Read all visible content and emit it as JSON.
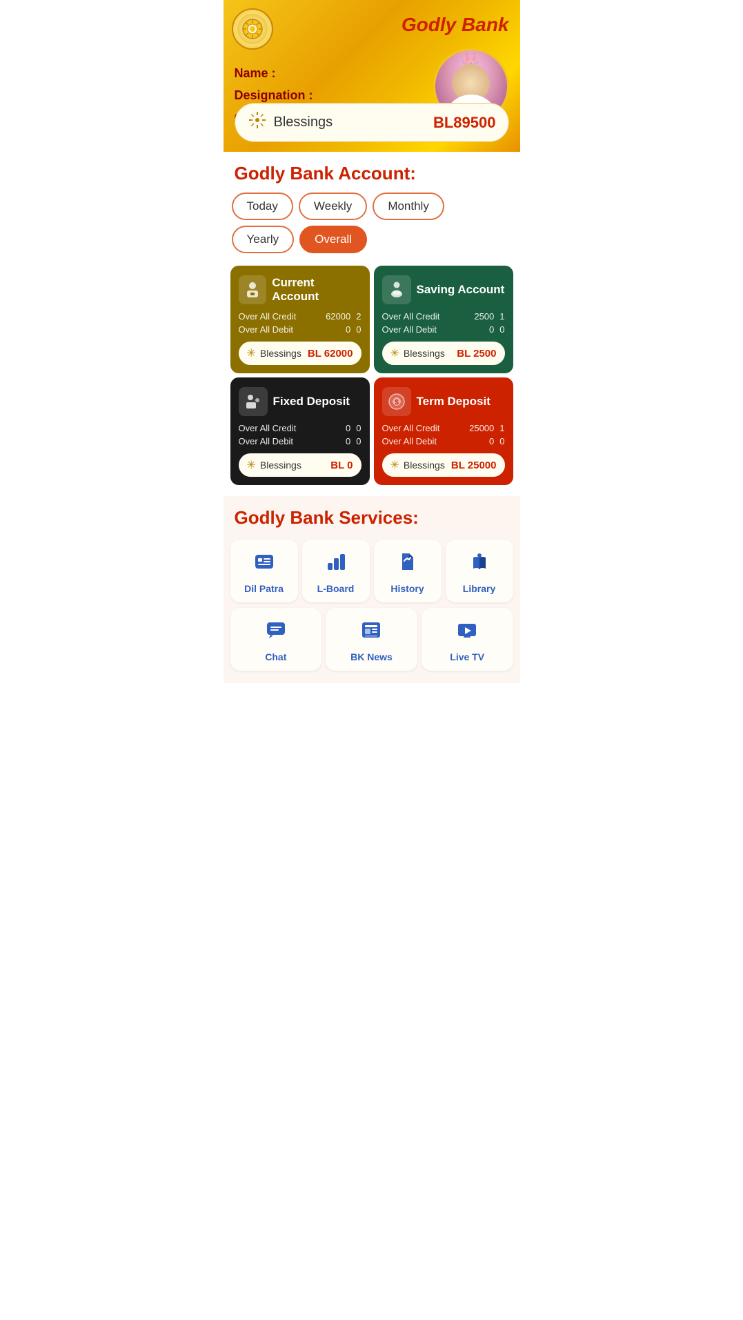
{
  "header": {
    "app_title": "Godly Bank",
    "name_label": "Name :",
    "designation_label": "Designation :",
    "crown_label": "Crown :",
    "blessings_label": "Blessings",
    "blessings_value": "BL89500"
  },
  "account_section": {
    "title": "Godly Bank Account:",
    "tabs": [
      "Today",
      "Weekly",
      "Monthly",
      "Yearly",
      "Overall"
    ],
    "active_tab": "Overall",
    "cards": [
      {
        "title": "Current Account",
        "icon": "banker",
        "type": "current",
        "over_all_credit_label": "Over All Credit",
        "over_all_credit_amount": "62000",
        "over_all_credit_count": "2",
        "over_all_debit_label": "Over All Debit",
        "over_all_debit_amount": "0",
        "over_all_debit_count": "0",
        "blessings_label": "Blessings",
        "blessings_value": "BL 62000",
        "color": "gold"
      },
      {
        "title": "Saving Account",
        "icon": "saving",
        "type": "saving",
        "over_all_credit_label": "Over All Credit",
        "over_all_credit_amount": "2500",
        "over_all_credit_count": "1",
        "over_all_debit_label": "Over All Debit",
        "over_all_debit_amount": "0",
        "over_all_debit_count": "0",
        "blessings_label": "Blessings",
        "blessings_value": "BL 2500",
        "color": "green"
      },
      {
        "title": "Fixed Deposit",
        "icon": "fixed",
        "type": "fixed",
        "over_all_credit_label": "Over All Credit",
        "over_all_credit_amount": "0",
        "over_all_credit_count": "0",
        "over_all_debit_label": "Over All Debit",
        "over_all_debit_amount": "0",
        "over_all_debit_count": "0",
        "blessings_label": "Blessings",
        "blessings_value": "BL 0",
        "color": "black"
      },
      {
        "title": "Term Deposit",
        "icon": "term",
        "type": "term",
        "over_all_credit_label": "Over All Credit",
        "over_all_credit_amount": "25000",
        "over_all_credit_count": "1",
        "over_all_debit_label": "Over All Debit",
        "over_all_debit_amount": "0",
        "over_all_debit_count": "0",
        "blessings_label": "Blessings",
        "blessings_value": "BL 25000",
        "color": "red"
      }
    ]
  },
  "services_section": {
    "title": "Godly Bank Services:",
    "row1": [
      {
        "label": "Dil Patra",
        "icon": "message-grid"
      },
      {
        "label": "L-Board",
        "icon": "bar-chart"
      },
      {
        "label": "History",
        "icon": "scroll"
      },
      {
        "label": "Library",
        "icon": "book"
      }
    ],
    "row2": [
      {
        "label": "Chat",
        "icon": "chat-bubble"
      },
      {
        "label": "BK News",
        "icon": "news"
      },
      {
        "label": "Live TV",
        "icon": "tv"
      }
    ]
  }
}
